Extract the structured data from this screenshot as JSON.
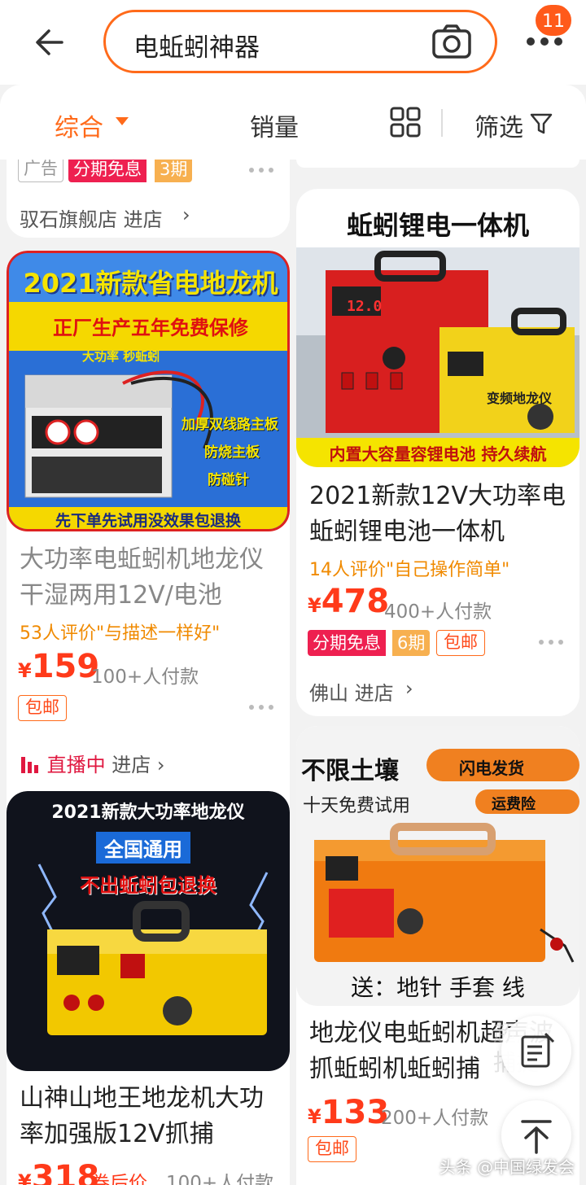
{
  "search": {
    "query": "电蚯蚓神器",
    "cart_count": "11"
  },
  "sortbar": {
    "composite": "综合",
    "sales": "销量",
    "filter": "筛选"
  },
  "left": {
    "top_card": {
      "ad": "广告",
      "installment": "分期免息",
      "periods": "3期",
      "store": "驭石旗舰店 进店"
    },
    "item1": {
      "img_headline": "2021新款省电地龙机",
      "img_sub": "正厂生产五年免费保修",
      "img_small": "大功率 秒蚯蚓",
      "img_side1": "加厚双线路主板",
      "img_side2": "防烧主板",
      "img_side3": "防碰针",
      "img_bottom": "先下单先试用没效果包退换",
      "title": "大功率电蚯蚓机地龙仪干湿两用12V/电池",
      "review": "53人评价\"与描述一样好\"",
      "price": "159",
      "sold": "100+人付款",
      "shipping": "包邮",
      "live": "直播中",
      "live_store": "进店"
    },
    "item2": {
      "img_headline": "2021新款大功率地龙仪",
      "img_badge": "全国通用",
      "img_red": "不出蚯蚓包退换",
      "title": "山神山地王地龙机大功率加强版12V抓捕",
      "price": "318",
      "coupon": "券后价",
      "sold": "100+人付款"
    }
  },
  "right": {
    "item1": {
      "img_headline": "蚯蚓锂电一体机",
      "img_bottom": "内置大容量容锂电池 持久续航",
      "img_device": "变频地龙仪",
      "display": "12.0",
      "title": "2021新款12V大功率电蚯蚓锂电池一体机",
      "review": "14人评价\"自己操作简单\"",
      "price": "478",
      "sold": "400+人付款",
      "installment": "分期免息",
      "periods": "6期",
      "shipping": "包邮",
      "store": "佛山 进店"
    },
    "item2": {
      "img_headline": "不限土壤",
      "img_fast": "闪电发货",
      "img_trial": "十天免费试用",
      "img_insurance": "运费险",
      "img_gift": "送：地针 手套 线",
      "title": "地龙仪电蚯蚓机超声波抓蚯蚓机蚯蚓捕",
      "price": "133",
      "sold": "200+人付款",
      "shipping": "包邮"
    }
  },
  "watermark": "头条 @中国绿发会",
  "ghost_text": "超声捕捉",
  "colors": {
    "accent": "#ff6a1a",
    "price": "#ff3a1a",
    "live": "#e01840"
  }
}
